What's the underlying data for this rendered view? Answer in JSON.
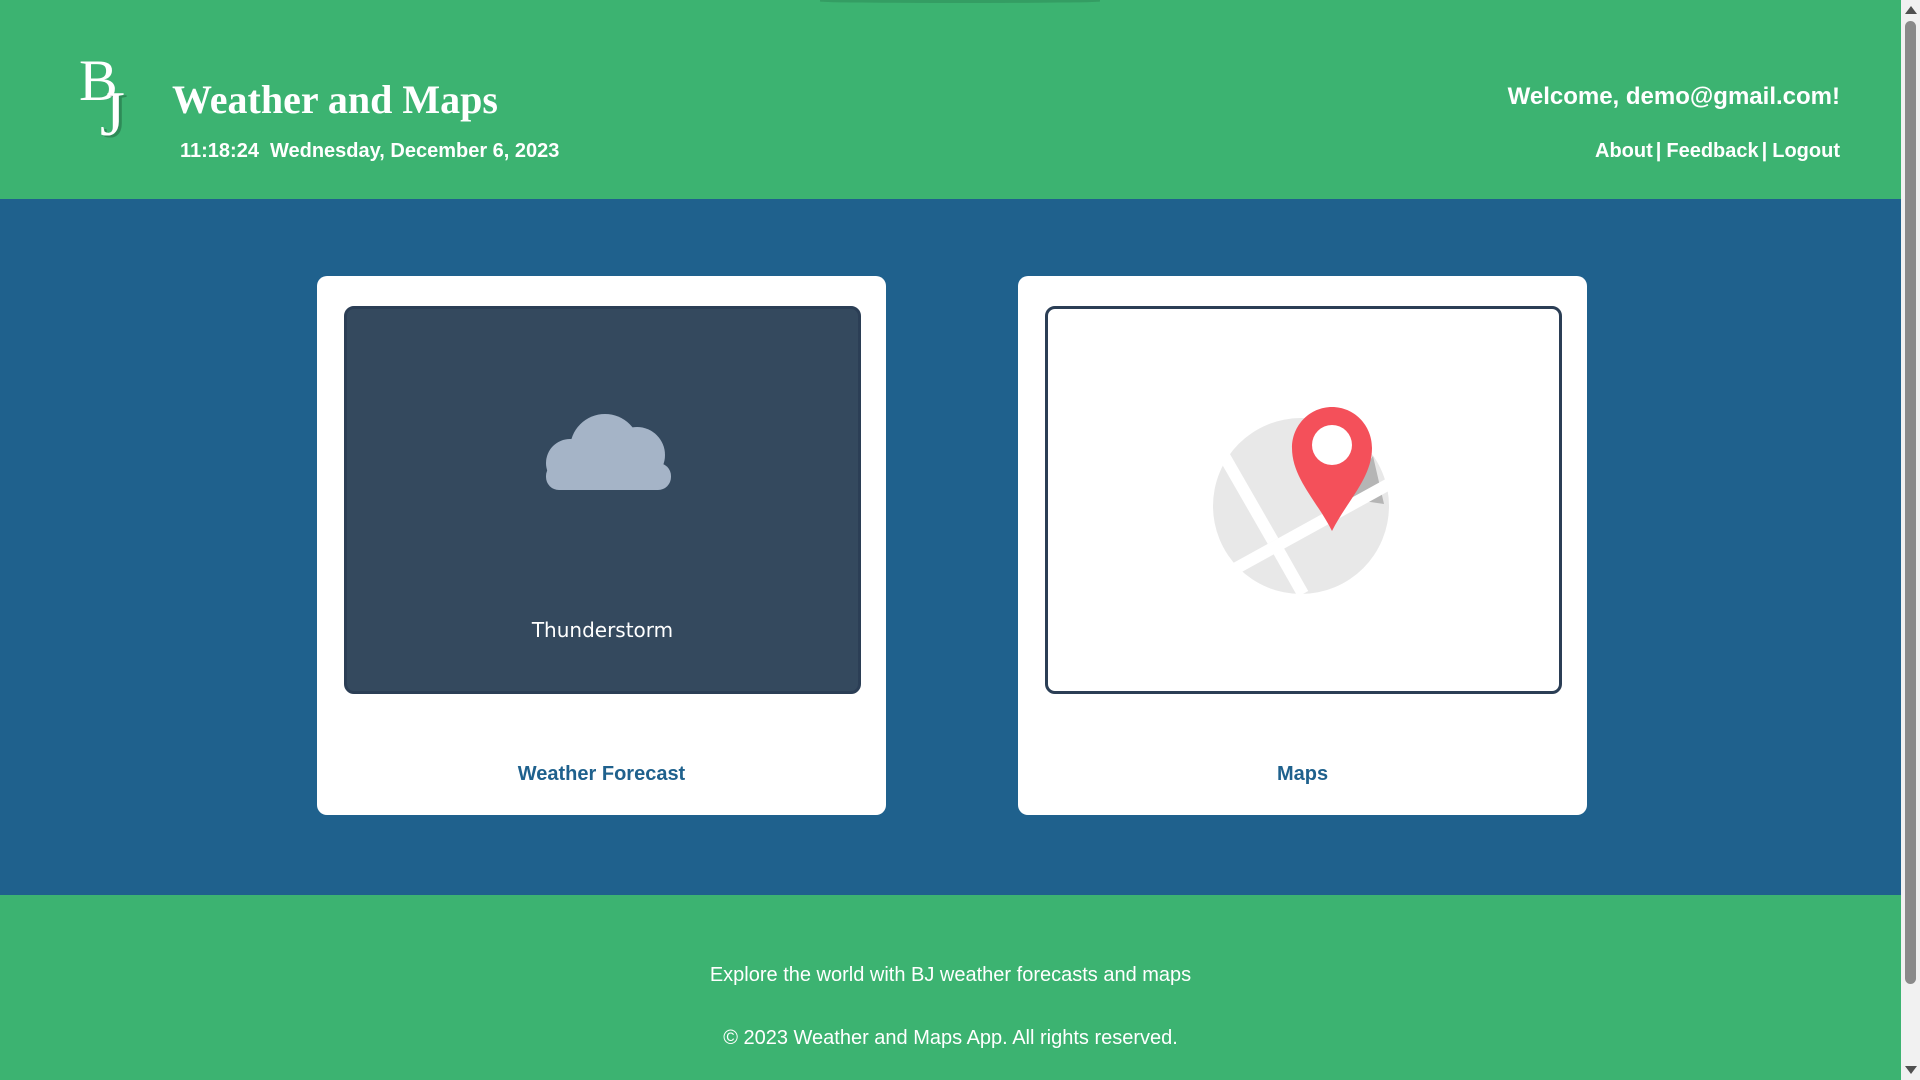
{
  "header": {
    "logo_letters": "BJ",
    "title": "Weather and Maps",
    "time": "11:18:24",
    "date": "Wednesday, December 6, 2023",
    "welcome": "Welcome, demo@gmail.com!",
    "nav": {
      "about": "About",
      "feedback": "Feedback",
      "logout": "Logout",
      "separator": "|"
    }
  },
  "cards": {
    "weather": {
      "icon": "cloud-icon",
      "condition": "Thunderstorm",
      "label": "Weather Forecast"
    },
    "maps": {
      "icon": "map-pin-icon",
      "label": "Maps"
    }
  },
  "footer": {
    "tagline": "Explore the world with BJ weather forecasts and maps",
    "copyright": "© 2023 Weather and Maps App. All rights reserved."
  },
  "colors": {
    "header_bg": "#3cb371",
    "main_bg": "#1f618d",
    "weather_card_inner": "#34495e",
    "cloud": "#a5b4c7",
    "pin": "#f4505a",
    "map_base": "#e8e8e8",
    "label_text": "#1f618d"
  }
}
